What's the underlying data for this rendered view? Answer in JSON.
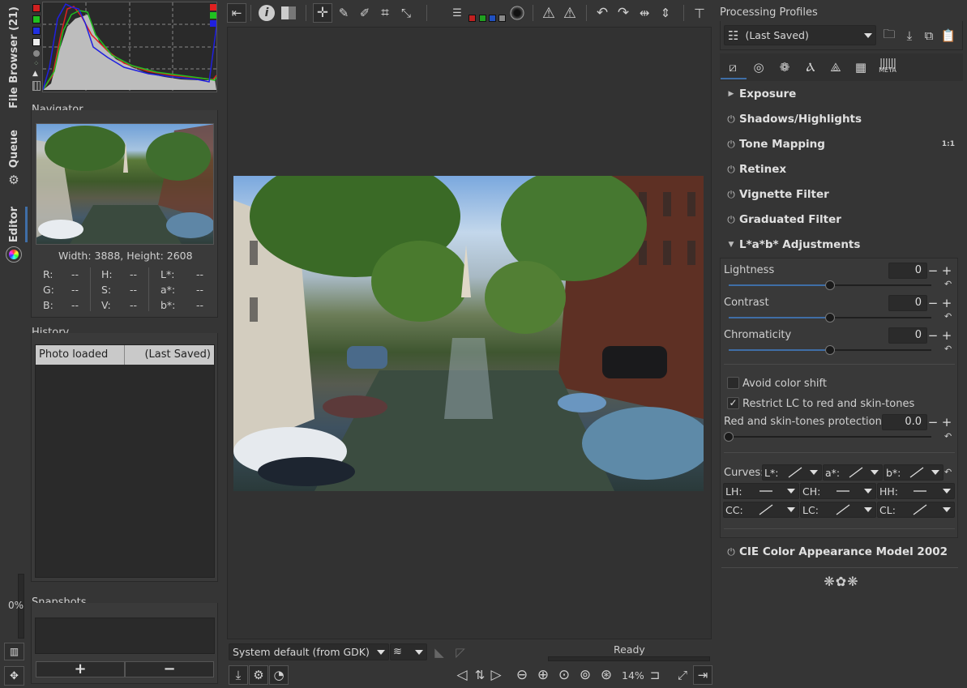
{
  "sidebar": {
    "tabs": [
      {
        "label": "File Browser (21)"
      },
      {
        "label": "Queue"
      },
      {
        "label": "Editor"
      }
    ],
    "progress_label": "0%"
  },
  "navigator": {
    "title": "Navigator",
    "size_text": "Width: 3888, Height: 2608",
    "readouts": [
      {
        "label": "R:",
        "value": "--"
      },
      {
        "label": "H:",
        "value": "--"
      },
      {
        "label": "L*:",
        "value": "--"
      },
      {
        "label": "G:",
        "value": "--"
      },
      {
        "label": "S:",
        "value": "--"
      },
      {
        "label": "a*:",
        "value": "--"
      },
      {
        "label": "B:",
        "value": "--"
      },
      {
        "label": "V:",
        "value": "--"
      },
      {
        "label": "b*:",
        "value": "--"
      }
    ]
  },
  "history": {
    "title": "History",
    "rows": [
      {
        "action": "Photo loaded",
        "profile": "(Last Saved)"
      }
    ]
  },
  "snapshots": {
    "title": "Snapshots",
    "add_label": "+",
    "remove_label": "−"
  },
  "bottom": {
    "monitor_profile": "System default (from GDK)",
    "status": "Ready",
    "zoom": "14%"
  },
  "profiles": {
    "title": "Processing Profiles",
    "selected": "(Last Saved)"
  },
  "tools": {
    "exposure": "Exposure",
    "shadows": "Shadows/Highlights",
    "tonemap": "Tone Mapping",
    "tonemap_badge": "1:1",
    "retinex": "Retinex",
    "vignette": "Vignette Filter",
    "graduated": "Graduated Filter",
    "lab": "L*a*b* Adjustments",
    "ciecam": "CIE Color Appearance Model 2002",
    "meta_label": "META"
  },
  "lab": {
    "sliders": [
      {
        "label": "Lightness",
        "value": "0",
        "fraction": 0.5
      },
      {
        "label": "Contrast",
        "value": "0",
        "fraction": 0.5
      },
      {
        "label": "Chromaticity",
        "value": "0",
        "fraction": 0.5
      }
    ],
    "avoid_color_shift": {
      "label": "Avoid color shift",
      "checked": false
    },
    "restrict_lc": {
      "label": "Restrict LC to red and skin-tones",
      "checked": true
    },
    "protection": {
      "label": "Red and skin-tones protection",
      "value": "0.0",
      "fraction": 0.0
    },
    "curves_label": "Curves:",
    "curves": [
      {
        "label": "L*:"
      },
      {
        "label": "a*:"
      },
      {
        "label": "b*:"
      },
      {
        "label": "LH:"
      },
      {
        "label": "CH:"
      },
      {
        "label": "HH:"
      },
      {
        "label": "CC:"
      },
      {
        "label": "LC:"
      },
      {
        "label": "CL:"
      }
    ]
  },
  "colors": {
    "accent_blue": "#3f6ea6",
    "histogram_red": "#e02020",
    "histogram_green": "#20c020",
    "histogram_blue": "#2020e0"
  }
}
